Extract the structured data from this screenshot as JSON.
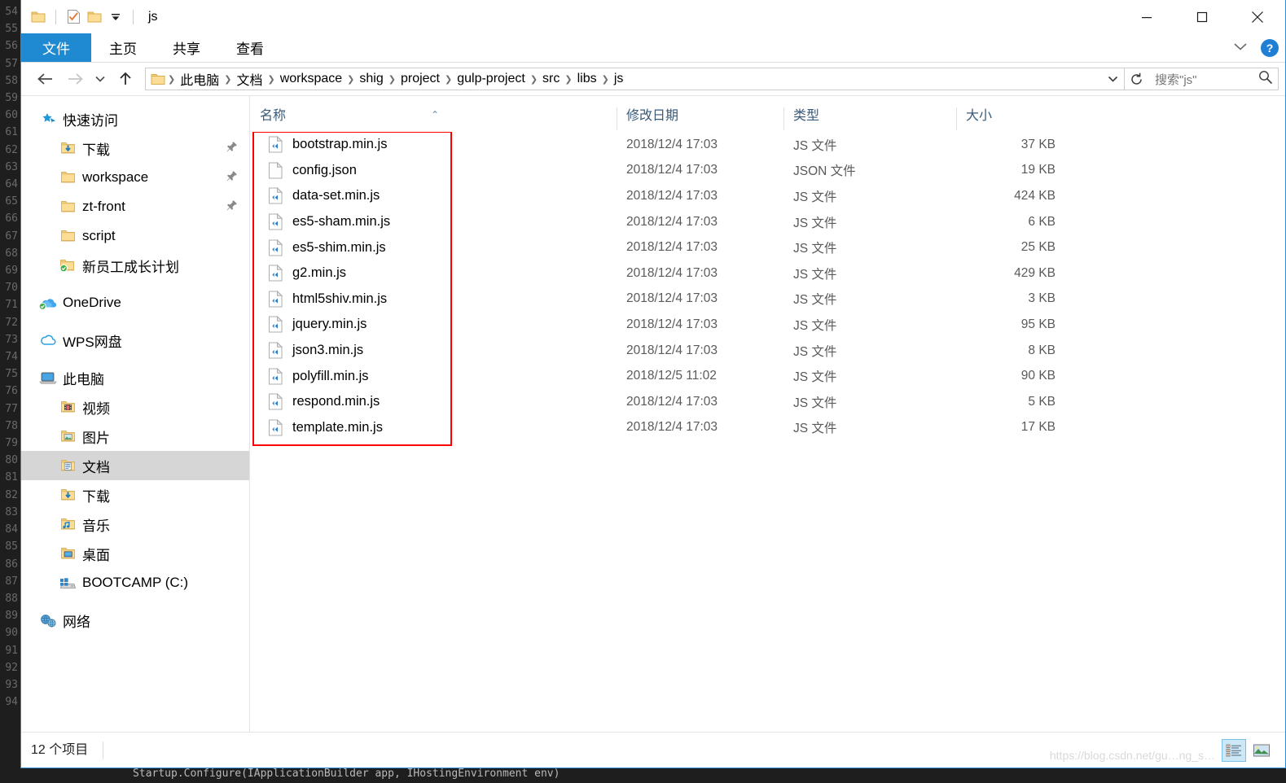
{
  "window": {
    "title": "js",
    "quick_access_icons": [
      "folder-icon",
      "properties-icon",
      "new-folder-icon",
      "customize-dropdown-icon"
    ],
    "minimize_label": "—",
    "maximize_label": "□",
    "close_label": "✕"
  },
  "ribbon": {
    "tabs": [
      {
        "label": "文件",
        "active": true
      },
      {
        "label": "主页",
        "active": false
      },
      {
        "label": "共享",
        "active": false
      },
      {
        "label": "查看",
        "active": false
      }
    ],
    "collapse_icon": "chevron-down-icon",
    "help_label": "?"
  },
  "navigation": {
    "back_icon": "arrow-left-icon",
    "forward_icon": "arrow-right-icon",
    "recent_icon": "chevron-down-icon",
    "up_icon": "arrow-up-icon",
    "breadcrumbs": [
      "此电脑",
      "文档",
      "workspace",
      "shig",
      "project",
      "gulp-project",
      "src",
      "libs",
      "js"
    ],
    "separator": "❯",
    "dropdown_icon": "chevron-down-icon",
    "refresh_icon": "refresh-icon"
  },
  "search": {
    "placeholder": "搜索\"js\"",
    "icon": "search-icon"
  },
  "sidebar": {
    "groups": [
      {
        "header": {
          "label": "快速访问",
          "icon": "star-pin-icon"
        },
        "items": [
          {
            "label": "下载",
            "icon": "folder-download-icon",
            "pinned": true,
            "pin_icon": "pin-icon"
          },
          {
            "label": "workspace",
            "icon": "folder-icon",
            "pinned": true,
            "pin_icon": "pin-icon"
          },
          {
            "label": "zt-front",
            "icon": "folder-icon",
            "pinned": true,
            "pin_icon": "pin-icon"
          },
          {
            "label": "script",
            "icon": "folder-icon",
            "pinned": false
          },
          {
            "label": "新员工成长计划",
            "icon": "folder-synced-icon",
            "pinned": false
          }
        ]
      },
      {
        "header": {
          "label": "OneDrive",
          "icon": "onedrive-icon"
        },
        "items": []
      },
      {
        "header": {
          "label": "WPS网盘",
          "icon": "cloud-icon"
        },
        "items": []
      },
      {
        "header": {
          "label": "此电脑",
          "icon": "this-pc-icon"
        },
        "items": [
          {
            "label": "视频",
            "icon": "folder-video-icon",
            "selected": false
          },
          {
            "label": "图片",
            "icon": "folder-pictures-icon",
            "selected": false
          },
          {
            "label": "文档",
            "icon": "folder-documents-icon",
            "selected": true
          },
          {
            "label": "下载",
            "icon": "folder-download-icon",
            "selected": false
          },
          {
            "label": "音乐",
            "icon": "folder-music-icon",
            "selected": false
          },
          {
            "label": "桌面",
            "icon": "folder-desktop-icon",
            "selected": false
          },
          {
            "label": "BOOTCAMP (C:)",
            "icon": "hard-drive-icon",
            "selected": false
          }
        ]
      },
      {
        "header": {
          "label": "网络",
          "icon": "network-icon"
        },
        "items": []
      }
    ]
  },
  "filelist": {
    "columns": [
      {
        "key": "name",
        "label": "名称",
        "sorted": true,
        "sort_dir": "asc",
        "sort_glyph": "⌃"
      },
      {
        "key": "date",
        "label": "修改日期"
      },
      {
        "key": "type",
        "label": "类型"
      },
      {
        "key": "size",
        "label": "大小"
      }
    ],
    "rows": [
      {
        "name": "bootstrap.min.js",
        "date": "2018/12/4 17:03",
        "type": "JS 文件",
        "size": "37 KB",
        "icon": "js-file-icon"
      },
      {
        "name": "config.json",
        "date": "2018/12/4 17:03",
        "type": "JSON 文件",
        "size": "19 KB",
        "icon": "generic-file-icon"
      },
      {
        "name": "data-set.min.js",
        "date": "2018/12/4 17:03",
        "type": "JS 文件",
        "size": "424 KB",
        "icon": "js-file-icon"
      },
      {
        "name": "es5-sham.min.js",
        "date": "2018/12/4 17:03",
        "type": "JS 文件",
        "size": "6 KB",
        "icon": "js-file-icon"
      },
      {
        "name": "es5-shim.min.js",
        "date": "2018/12/4 17:03",
        "type": "JS 文件",
        "size": "25 KB",
        "icon": "js-file-icon"
      },
      {
        "name": "g2.min.js",
        "date": "2018/12/4 17:03",
        "type": "JS 文件",
        "size": "429 KB",
        "icon": "js-file-icon"
      },
      {
        "name": "html5shiv.min.js",
        "date": "2018/12/4 17:03",
        "type": "JS 文件",
        "size": "3 KB",
        "icon": "js-file-icon"
      },
      {
        "name": "jquery.min.js",
        "date": "2018/12/4 17:03",
        "type": "JS 文件",
        "size": "95 KB",
        "icon": "js-file-icon"
      },
      {
        "name": "json3.min.js",
        "date": "2018/12/4 17:03",
        "type": "JS 文件",
        "size": "8 KB",
        "icon": "js-file-icon"
      },
      {
        "name": "polyfill.min.js",
        "date": "2018/12/5 11:02",
        "type": "JS 文件",
        "size": "90 KB",
        "icon": "js-file-icon"
      },
      {
        "name": "respond.min.js",
        "date": "2018/12/4 17:03",
        "type": "JS 文件",
        "size": "5 KB",
        "icon": "js-file-icon"
      },
      {
        "name": "template.min.js",
        "date": "2018/12/4 17:03",
        "type": "JS 文件",
        "size": "17 KB",
        "icon": "js-file-icon"
      }
    ]
  },
  "annotation": {
    "highlight_color": "#fe0000"
  },
  "statusbar": {
    "item_count_text": "12 个项目",
    "views": [
      {
        "name": "details-view",
        "active": true
      },
      {
        "name": "large-icons-view",
        "active": false
      }
    ]
  },
  "watermark": {
    "text": "https://blog.csdn.net/gu…ng_s…"
  },
  "background_editor": {
    "gutter_numbers": [
      "54",
      "55",
      "56",
      "57",
      "58",
      "59",
      "60",
      "61",
      "62",
      "63",
      "64",
      "65",
      "66",
      "67",
      "68",
      "69",
      "70",
      "71",
      "72",
      "73",
      "74",
      "75",
      "76",
      "77",
      "78",
      "79",
      "80",
      "81",
      "82",
      "83",
      "84",
      "85",
      "86",
      "87",
      "88",
      "89",
      "90",
      "91",
      "92",
      "93",
      "94"
    ],
    "bottom_line": "                 Startup.Configure(IApplicationBuilder app, IHostingEnvironment env)"
  },
  "colors": {
    "accent": "#1f8ad2",
    "selected_row": "#d6d6d6",
    "folder": "#f7d27c",
    "annotation": "#fe0000"
  }
}
